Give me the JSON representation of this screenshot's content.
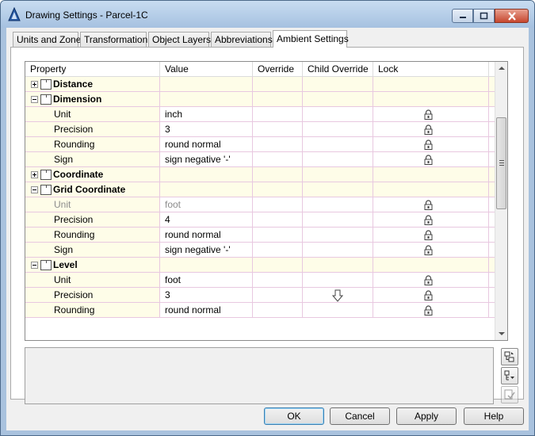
{
  "window": {
    "title": "Drawing Settings - Parcel-1C"
  },
  "tabs": [
    {
      "label": "Units and Zone",
      "active": false
    },
    {
      "label": "Transformation",
      "active": false
    },
    {
      "label": "Object Layers",
      "active": false
    },
    {
      "label": "Abbreviations",
      "active": false
    },
    {
      "label": "Ambient Settings",
      "active": true
    }
  ],
  "grid": {
    "columns": [
      "Property",
      "Value",
      "Override",
      "Child Override",
      "Lock"
    ],
    "rows": [
      {
        "type": "group",
        "expander": "plus",
        "label": "Distance"
      },
      {
        "type": "group",
        "expander": "minus",
        "label": "Dimension"
      },
      {
        "type": "leaf",
        "label": "Unit",
        "value": "inch",
        "lock": true,
        "disabled": false
      },
      {
        "type": "leaf",
        "label": "Precision",
        "value": "3",
        "lock": true,
        "disabled": false
      },
      {
        "type": "leaf",
        "label": "Rounding",
        "value": "round normal",
        "lock": true,
        "disabled": false
      },
      {
        "type": "leaf",
        "label": "Sign",
        "value": "sign negative '-'",
        "lock": true,
        "disabled": false
      },
      {
        "type": "group",
        "expander": "plus",
        "label": "Coordinate"
      },
      {
        "type": "group",
        "expander": "minus",
        "label": "Grid Coordinate"
      },
      {
        "type": "leaf",
        "label": "Unit",
        "value": "foot",
        "lock": true,
        "disabled": true
      },
      {
        "type": "leaf",
        "label": "Precision",
        "value": "4",
        "lock": true,
        "disabled": false
      },
      {
        "type": "leaf",
        "label": "Rounding",
        "value": "round normal",
        "lock": true,
        "disabled": false
      },
      {
        "type": "leaf",
        "label": "Sign",
        "value": "sign negative '-'",
        "lock": true,
        "disabled": false
      },
      {
        "type": "group",
        "expander": "minus",
        "label": "Level"
      },
      {
        "type": "leaf",
        "label": "Unit",
        "value": "foot",
        "lock": true,
        "disabled": false
      },
      {
        "type": "leaf",
        "label": "Precision",
        "value": "3",
        "lock": true,
        "disabled": false,
        "child_override_icon": "down-arrow-icon"
      },
      {
        "type": "leaf",
        "label": "Rounding",
        "value": "round normal",
        "lock": true,
        "disabled": false
      }
    ]
  },
  "buttons": {
    "ok": "OK",
    "cancel": "Cancel",
    "apply": "Apply",
    "help": "Help"
  }
}
